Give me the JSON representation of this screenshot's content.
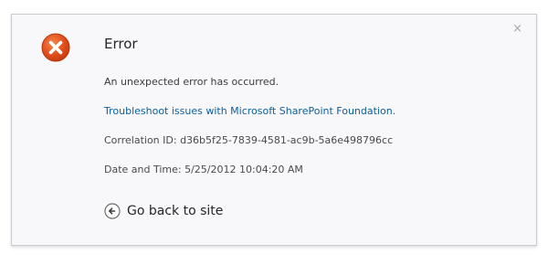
{
  "dialog": {
    "close_glyph": "×",
    "title": "Error",
    "message": "An unexpected error has occurred.",
    "troubleshoot_link": "Troubleshoot issues with Microsoft SharePoint Foundation.",
    "correlation": "Correlation ID: d36b5f25-7839-4581-ac9b-5a6e498796cc",
    "datetime": "Date and Time: 5/25/2012 10:04:20 AM",
    "back_label": "Go back to site",
    "icons": {
      "error": "error-x-icon",
      "back": "back-arrow-circle-icon",
      "close": "close-icon"
    },
    "colors": {
      "error_icon": "#e24e1b",
      "link": "#0a5f9b"
    }
  }
}
